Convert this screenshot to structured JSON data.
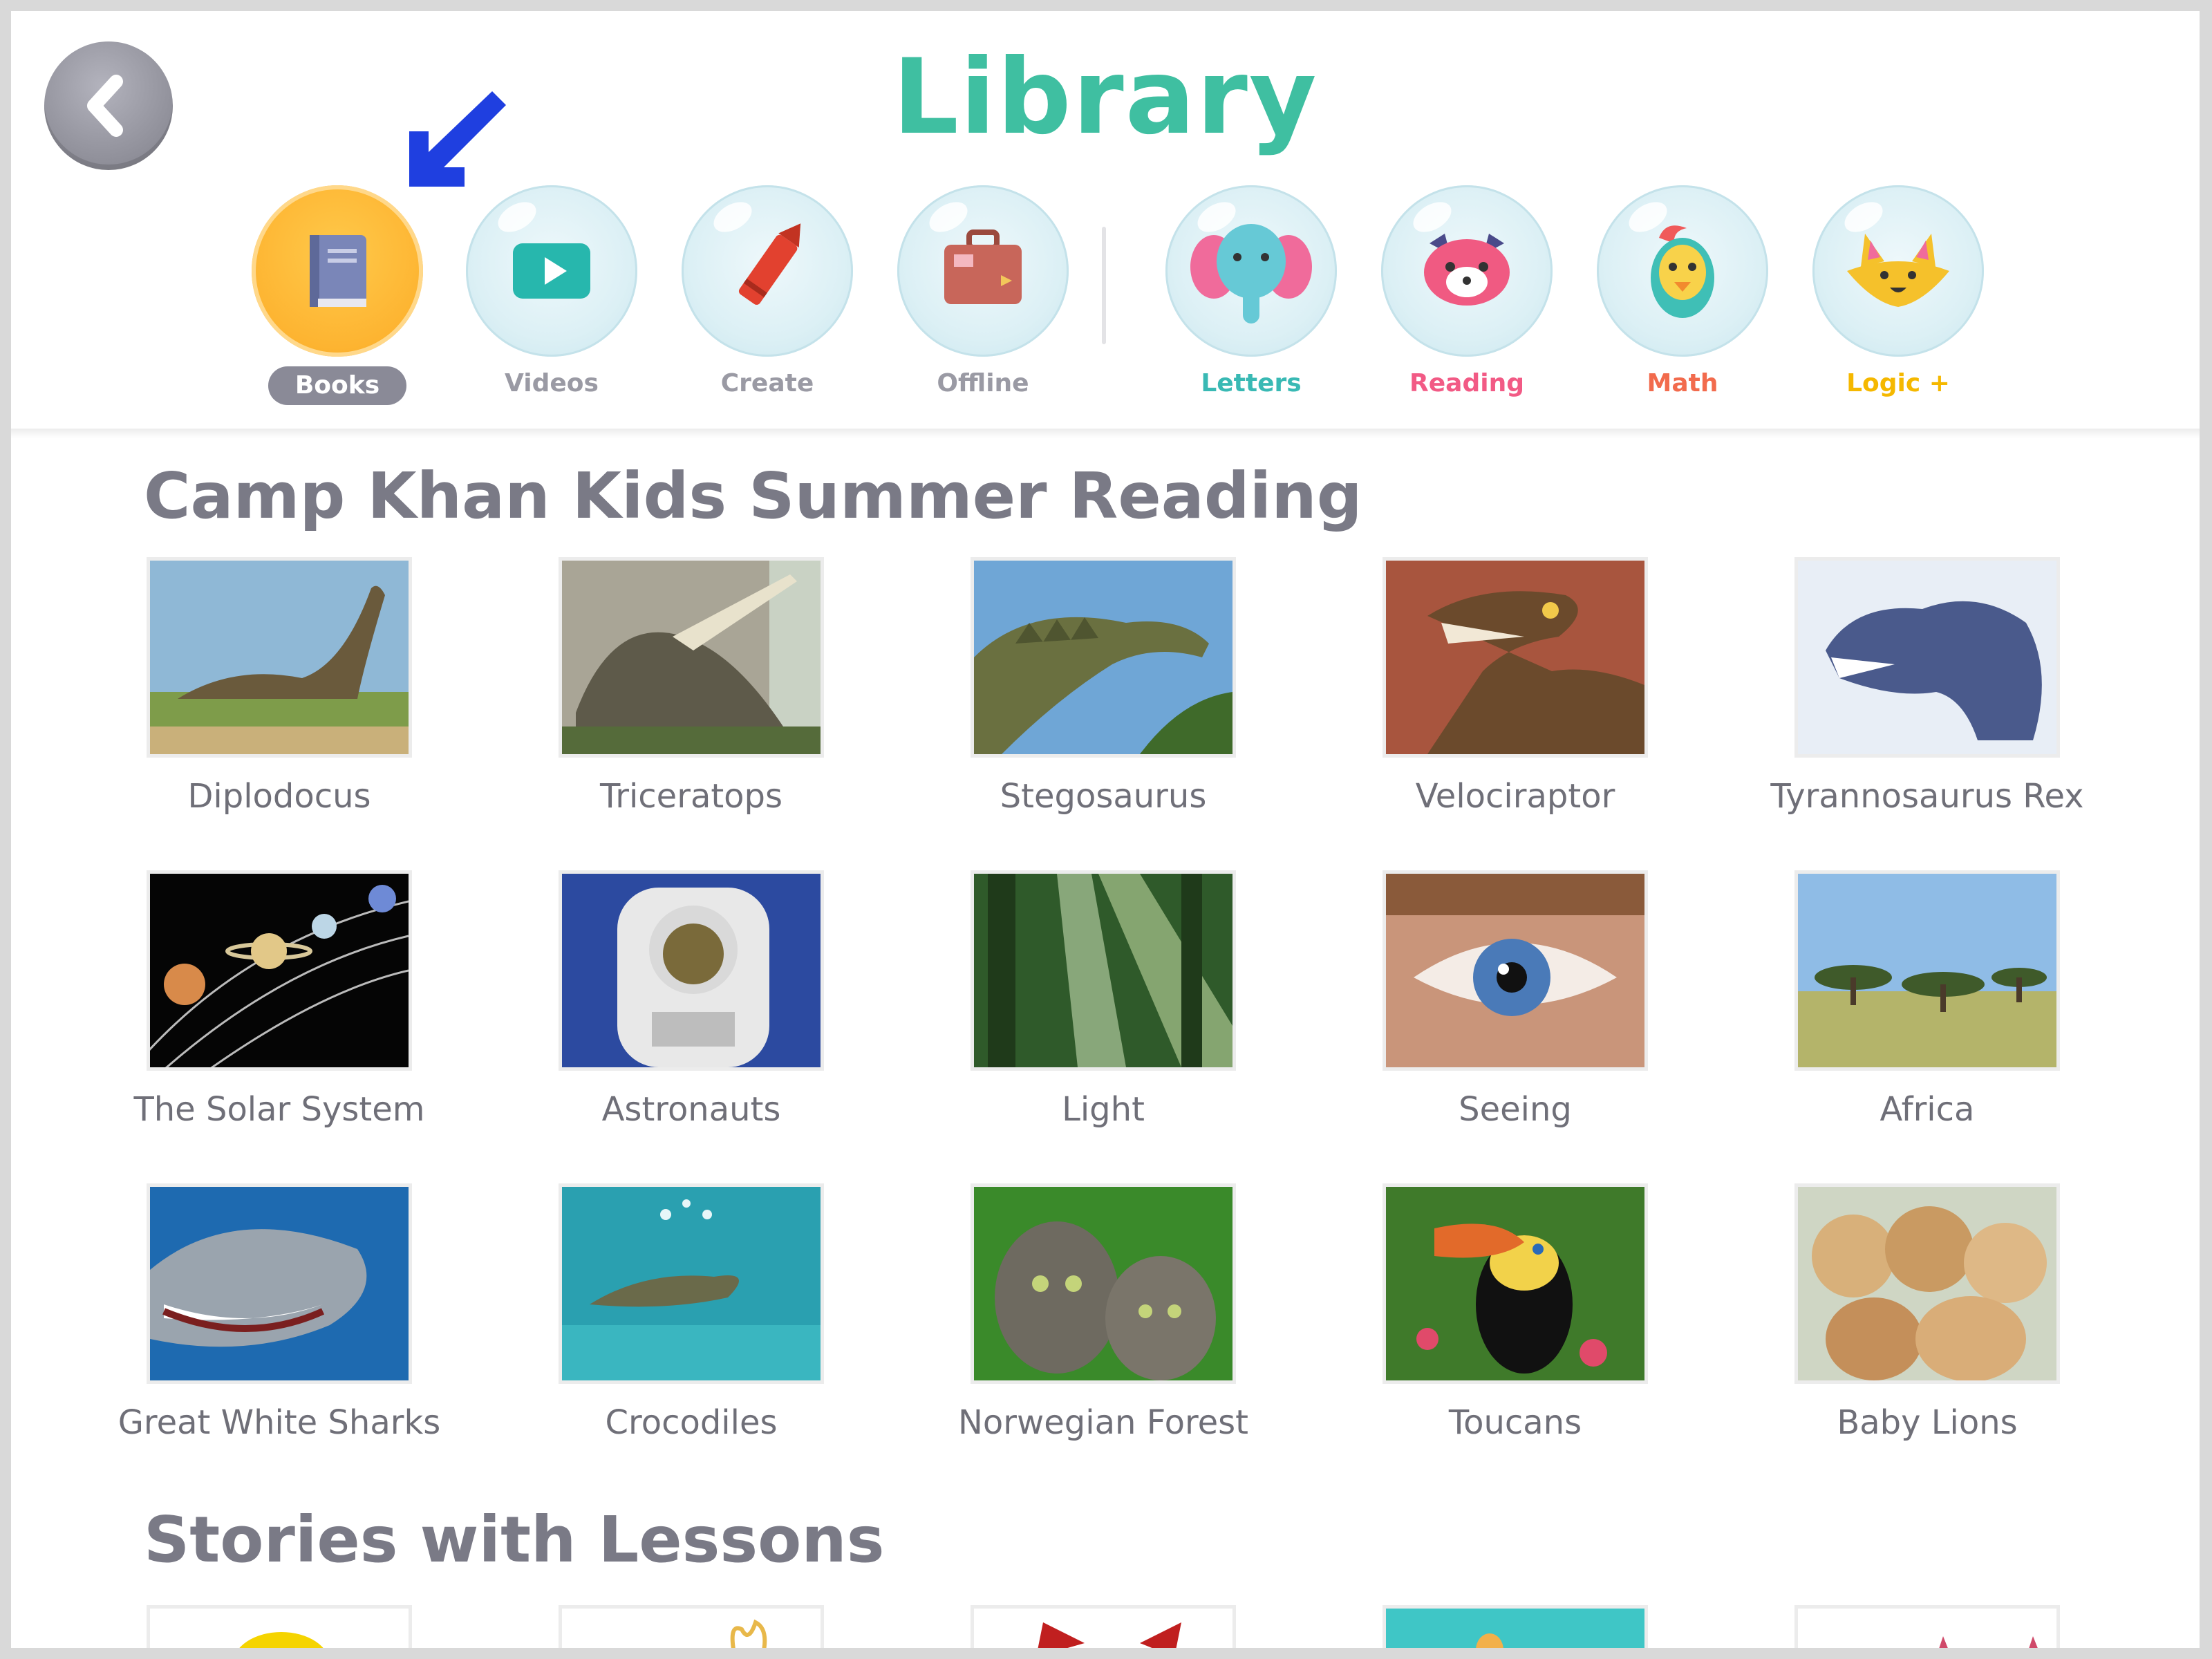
{
  "header": {
    "title": "Library",
    "back_icon": "chevron-left-icon"
  },
  "nav": {
    "items": [
      {
        "label": "Books",
        "icon": "book-icon",
        "active": true,
        "color": "#ffffff"
      },
      {
        "label": "Videos",
        "icon": "play-icon",
        "active": false,
        "color": "#9a9aa4"
      },
      {
        "label": "Create",
        "icon": "crayon-icon",
        "active": false,
        "color": "#9a9aa4"
      },
      {
        "label": "Offline",
        "icon": "suitcase-icon",
        "active": false,
        "color": "#9a9aa4"
      },
      {
        "label": "Letters",
        "icon": "elephant-icon",
        "active": false,
        "color": "#39b9b4"
      },
      {
        "label": "Reading",
        "icon": "red-panda-icon",
        "active": false,
        "color": "#f25a85"
      },
      {
        "label": "Math",
        "icon": "bird-icon",
        "active": false,
        "color": "#f26b4d"
      },
      {
        "label": "Logic +",
        "icon": "fox-icon",
        "active": false,
        "color": "#f5b800"
      }
    ]
  },
  "sections": [
    {
      "title": "Camp Khan Kids Summer Reading",
      "books": [
        {
          "label": "Diplodocus"
        },
        {
          "label": "Triceratops"
        },
        {
          "label": "Stegosaurus"
        },
        {
          "label": "Velociraptor"
        },
        {
          "label": "Tyrannosaurus Rex"
        },
        {
          "label": "The Solar System"
        },
        {
          "label": "Astronauts"
        },
        {
          "label": "Light"
        },
        {
          "label": "Seeing"
        },
        {
          "label": "Africa"
        },
        {
          "label": "Great White Sharks"
        },
        {
          "label": "Crocodiles"
        },
        {
          "label": "Norwegian Forest"
        },
        {
          "label": "Toucans"
        },
        {
          "label": "Baby Lions"
        }
      ]
    },
    {
      "title": "Stories with Lessons"
    }
  ],
  "colors": {
    "accent_title": "#3fbfa1",
    "active_tab": "#fdb431",
    "pointer_arrow": "#1f3fe0",
    "section_title": "#7a7a86"
  }
}
